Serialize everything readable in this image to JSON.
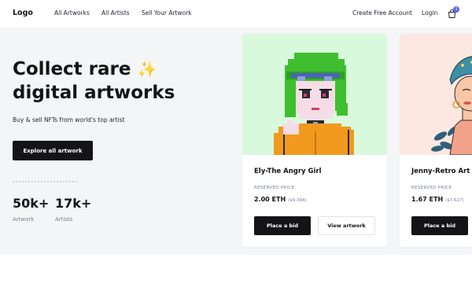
{
  "nav": {
    "logo": "Logo",
    "links": [
      "All Artworks",
      "All Artists",
      "Sell Your Artwork"
    ],
    "create_account": "Create Free Account",
    "login": "Login",
    "cart_icon": "shopping-bag-icon",
    "cart_count": "3",
    "accent": "#5b5ff5"
  },
  "hero": {
    "title_line1": "Collect rare",
    "sparkle": "✨",
    "title_line2": "digital artworks",
    "subtitle": "Buy & sell NFTs from world's top artist",
    "cta": "Explore all artwork",
    "stats": [
      {
        "value": "50k+",
        "label": "Artwork"
      },
      {
        "value": "17k+",
        "label": "Artists"
      }
    ]
  },
  "cards": [
    {
      "title": "Ely-The Angry Girl",
      "price_label": "RESERVED PRICE",
      "price": "2.00 ETH",
      "usd": "($9,394)",
      "bid_label": "Place a bid",
      "view_label": "View artwork",
      "bg": "#d9f9dd"
    },
    {
      "title": "Jenny-Retro Art",
      "price_label": "RESERVED PRICE",
      "price": "1.67 ETH",
      "usd": "($7,627)",
      "bid_label": "Place a bid",
      "bg": "#fde8e1"
    }
  ]
}
